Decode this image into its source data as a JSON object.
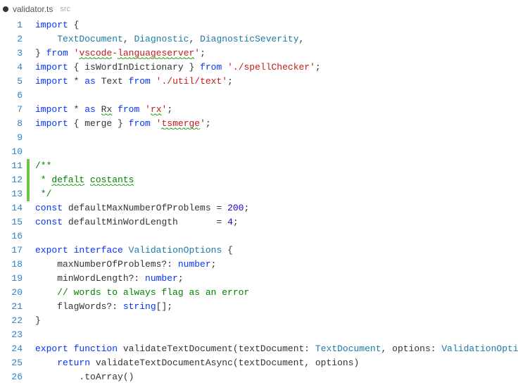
{
  "tab": {
    "dirty": true,
    "filename": "validator.ts",
    "path_hint": "src"
  },
  "totalLines": 26,
  "lines": {
    "l1": {
      "tokens": [
        {
          "t": "import",
          "c": "kw"
        },
        {
          "t": " {"
        }
      ]
    },
    "l2": {
      "tokens": [
        {
          "t": "    "
        },
        {
          "t": "TextDocument",
          "c": "type"
        },
        {
          "t": ", "
        },
        {
          "t": "Diagnostic",
          "c": "type"
        },
        {
          "t": ", "
        },
        {
          "t": "DiagnosticSeverity",
          "c": "type"
        },
        {
          "t": ","
        }
      ]
    },
    "l3": {
      "tokens": [
        {
          "t": "} "
        },
        {
          "t": "from",
          "c": "kw"
        },
        {
          "t": " "
        },
        {
          "t": "'",
          "c": "str"
        },
        {
          "t": "vscode",
          "c": "str",
          "sq": true
        },
        {
          "t": "-",
          "c": "str"
        },
        {
          "t": "languageserver",
          "c": "str",
          "sq": true
        },
        {
          "t": "'",
          "c": "str"
        },
        {
          "t": ";"
        }
      ]
    },
    "l4": {
      "tokens": [
        {
          "t": "import",
          "c": "kw"
        },
        {
          "t": " { "
        },
        {
          "t": "isWordInDictionary"
        },
        {
          "t": " } "
        },
        {
          "t": "from",
          "c": "kw"
        },
        {
          "t": " "
        },
        {
          "t": "'./spellChecker'",
          "c": "str"
        },
        {
          "t": ";"
        }
      ]
    },
    "l5": {
      "tokens": [
        {
          "t": "import",
          "c": "kw"
        },
        {
          "t": " * "
        },
        {
          "t": "as",
          "c": "kw"
        },
        {
          "t": " Text "
        },
        {
          "t": "from",
          "c": "kw"
        },
        {
          "t": " "
        },
        {
          "t": "'./util/text'",
          "c": "str"
        },
        {
          "t": ";"
        }
      ]
    },
    "l6": {
      "tokens": [
        {
          "t": ""
        }
      ]
    },
    "l7": {
      "tokens": [
        {
          "t": "import",
          "c": "kw"
        },
        {
          "t": " * "
        },
        {
          "t": "as",
          "c": "kw"
        },
        {
          "t": " "
        },
        {
          "t": "Rx",
          "sq": true
        },
        {
          "t": " "
        },
        {
          "t": "from",
          "c": "kw"
        },
        {
          "t": " "
        },
        {
          "t": "'",
          "c": "str"
        },
        {
          "t": "rx",
          "c": "str",
          "sq": true
        },
        {
          "t": "'",
          "c": "str"
        },
        {
          "t": ";"
        }
      ]
    },
    "l8": {
      "tokens": [
        {
          "t": "import",
          "c": "kw"
        },
        {
          "t": " { merge } "
        },
        {
          "t": "from",
          "c": "kw"
        },
        {
          "t": " "
        },
        {
          "t": "'",
          "c": "str"
        },
        {
          "t": "tsmerge",
          "c": "str",
          "sq": true
        },
        {
          "t": "'",
          "c": "str"
        },
        {
          "t": ";"
        }
      ]
    },
    "l9": {
      "tokens": [
        {
          "t": ""
        }
      ]
    },
    "l10": {
      "tokens": [
        {
          "t": ""
        }
      ]
    },
    "l11": {
      "tokens": [
        {
          "t": "/**",
          "c": "cmt"
        }
      ]
    },
    "l12": {
      "tokens": [
        {
          "t": " * ",
          "c": "cmt"
        },
        {
          "t": "defalt",
          "c": "cmt",
          "sq": true
        },
        {
          "t": " ",
          "c": "cmt"
        },
        {
          "t": "costants",
          "c": "cmt",
          "sq": true
        }
      ]
    },
    "l13": {
      "tokens": [
        {
          "t": " */",
          "c": "cmt"
        }
      ]
    },
    "l14": {
      "tokens": [
        {
          "t": "const",
          "c": "kw"
        },
        {
          "t": " defaultMaxNumberOfProblems = "
        },
        {
          "t": "200",
          "c": "num"
        },
        {
          "t": ";"
        }
      ]
    },
    "l15": {
      "tokens": [
        {
          "t": "const",
          "c": "kw"
        },
        {
          "t": " defaultMinWordLength       = "
        },
        {
          "t": "4",
          "c": "num"
        },
        {
          "t": ";"
        }
      ]
    },
    "l16": {
      "tokens": [
        {
          "t": ""
        }
      ]
    },
    "l17": {
      "tokens": [
        {
          "t": "export",
          "c": "kw"
        },
        {
          "t": " "
        },
        {
          "t": "interface",
          "c": "kw"
        },
        {
          "t": " "
        },
        {
          "t": "ValidationOptions",
          "c": "type"
        },
        {
          "t": " {"
        }
      ]
    },
    "l18": {
      "tokens": [
        {
          "t": "    maxNumberOfProblems?: "
        },
        {
          "t": "number",
          "c": "kw"
        },
        {
          "t": ";"
        }
      ]
    },
    "l19": {
      "tokens": [
        {
          "t": "    minWordLength?: "
        },
        {
          "t": "number",
          "c": "kw"
        },
        {
          "t": ";"
        }
      ]
    },
    "l20": {
      "tokens": [
        {
          "t": "    "
        },
        {
          "t": "// words to always flag as an error",
          "c": "cmt"
        }
      ]
    },
    "l21": {
      "tokens": [
        {
          "t": "    flagWords?: "
        },
        {
          "t": "string",
          "c": "kw"
        },
        {
          "t": "[];"
        }
      ]
    },
    "l22": {
      "tokens": [
        {
          "t": "}"
        }
      ]
    },
    "l23": {
      "tokens": [
        {
          "t": ""
        }
      ]
    },
    "l24": {
      "tokens": [
        {
          "t": "export",
          "c": "kw"
        },
        {
          "t": " "
        },
        {
          "t": "function",
          "c": "kw"
        },
        {
          "t": " "
        },
        {
          "t": "validateTextDocument",
          "c": "fn"
        },
        {
          "t": "(textDocument: "
        },
        {
          "t": "TextDocument",
          "c": "type"
        },
        {
          "t": ", options: "
        },
        {
          "t": "ValidationOpti",
          "c": "type"
        }
      ]
    },
    "l25": {
      "tokens": [
        {
          "t": "    "
        },
        {
          "t": "return",
          "c": "kw"
        },
        {
          "t": " validateTextDocumentAsync(textDocument, options)"
        }
      ]
    },
    "l26": {
      "tokens": [
        {
          "t": "        .toArray()"
        }
      ]
    }
  },
  "diffAdded": {
    "startLine": 11,
    "endLine": 13
  }
}
